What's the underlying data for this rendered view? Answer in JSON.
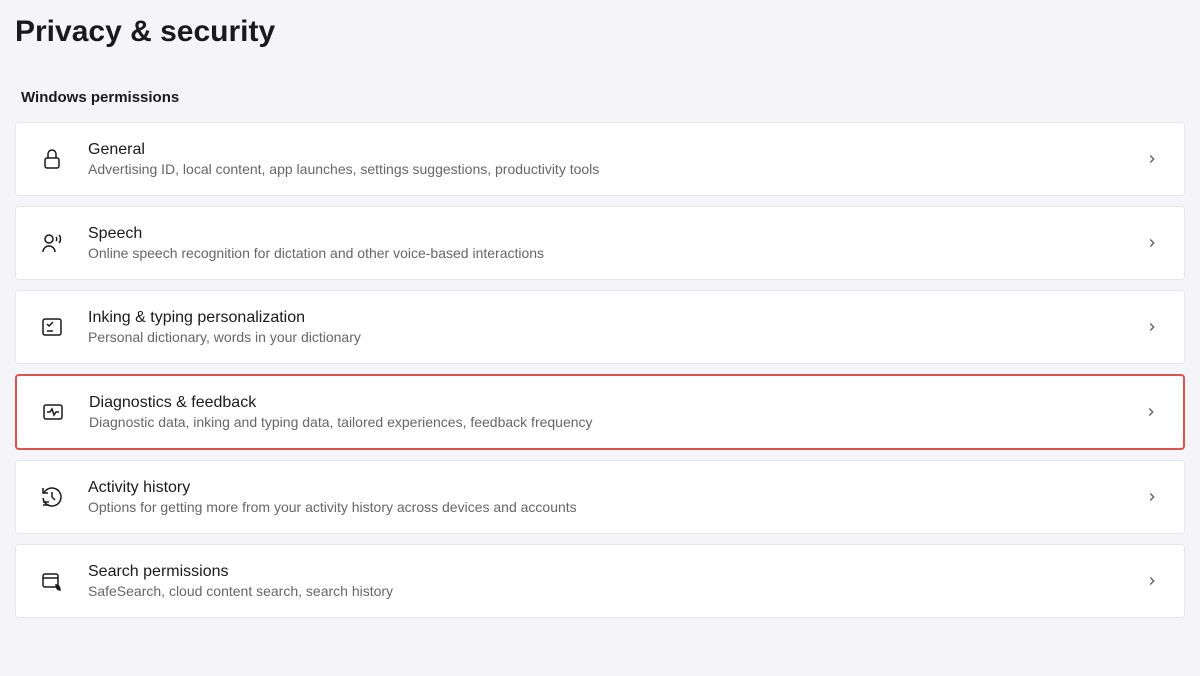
{
  "pageTitle": "Privacy & security",
  "sectionHeader": "Windows permissions",
  "items": [
    {
      "title": "General",
      "description": "Advertising ID, local content, app launches, settings suggestions, productivity tools",
      "highlighted": false
    },
    {
      "title": "Speech",
      "description": "Online speech recognition for dictation and other voice-based interactions",
      "highlighted": false
    },
    {
      "title": "Inking & typing personalization",
      "description": "Personal dictionary, words in your dictionary",
      "highlighted": false
    },
    {
      "title": "Diagnostics & feedback",
      "description": "Diagnostic data, inking and typing data, tailored experiences, feedback frequency",
      "highlighted": true
    },
    {
      "title": "Activity history",
      "description": "Options for getting more from your activity history across devices and accounts",
      "highlighted": false
    },
    {
      "title": "Search permissions",
      "description": "SafeSearch, cloud content search, search history",
      "highlighted": false
    }
  ]
}
